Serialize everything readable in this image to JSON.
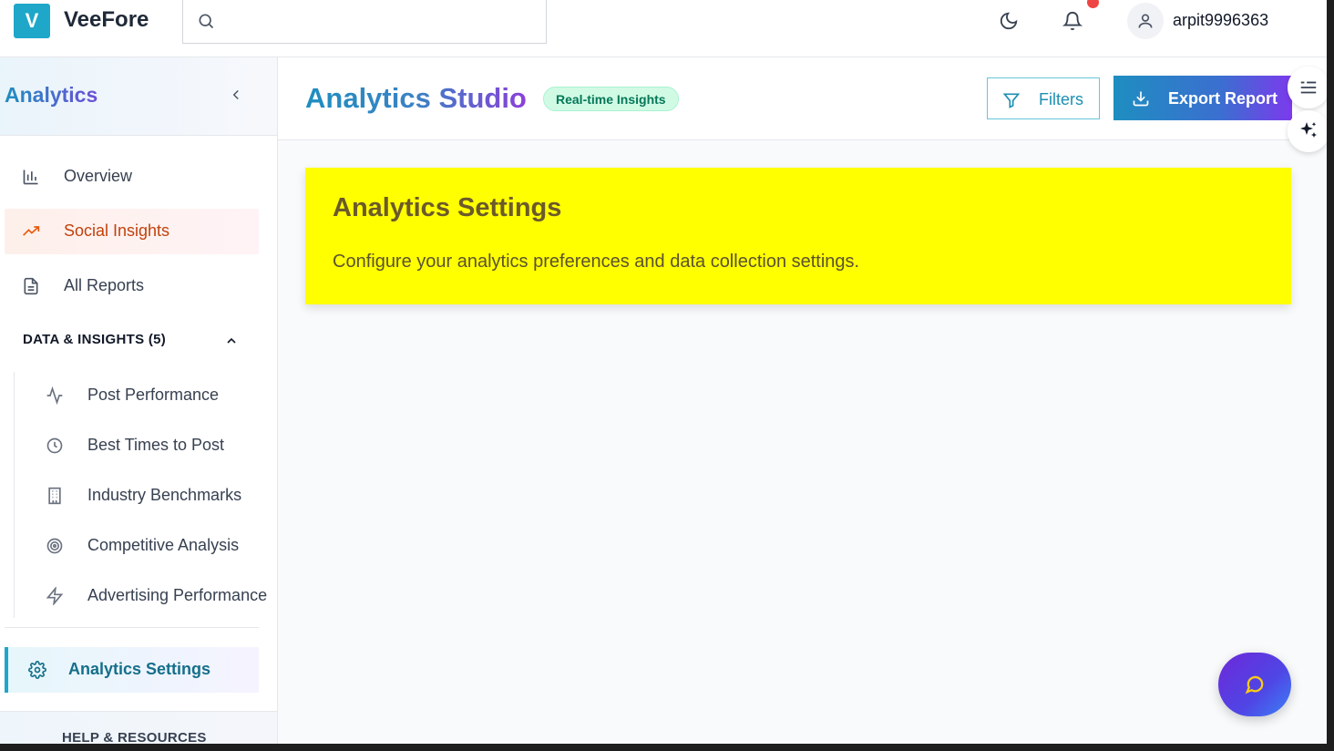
{
  "brand": {
    "logo_letter": "V",
    "name": "VeeFore",
    "accent": "#1ea7c9"
  },
  "search": {
    "placeholder": ""
  },
  "topbar": {
    "icons": [
      "moon-icon",
      "bell-icon",
      "user-icon"
    ],
    "notification_dot_color": "#ef4444",
    "username": "arpit9996363"
  },
  "sidebar": {
    "title": "Analytics",
    "items": [
      {
        "label": "Overview",
        "icon": "bar-chart-icon",
        "active": false
      },
      {
        "label": "Social Insights",
        "icon": "trending-up-icon",
        "active": true
      },
      {
        "label": "All Reports",
        "icon": "document-icon",
        "active": false
      }
    ],
    "section": {
      "label": "DATA & INSIGHTS (5)",
      "expanded": true,
      "items": [
        {
          "label": "Post Performance",
          "icon": "activity-icon"
        },
        {
          "label": "Best Times to Post",
          "icon": "clock-icon"
        },
        {
          "label": "Industry Benchmarks",
          "icon": "building-icon"
        },
        {
          "label": "Competitive Analysis",
          "icon": "target-icon"
        },
        {
          "label": "Advertising Performance",
          "icon": "zap-icon"
        }
      ]
    },
    "settings": {
      "label": "Analytics Settings",
      "icon": "gear-icon",
      "selected": true
    },
    "footer": {
      "label": "HELP & RESOURCES"
    }
  },
  "main": {
    "title": "Analytics Studio",
    "badge": "Real-time Insights",
    "filters_label": "Filters",
    "export_label": "Export Report",
    "card": {
      "title": "Analytics Settings",
      "description": "Configure your analytics preferences and data collection settings.",
      "background": "#ffff00"
    }
  },
  "floating": {
    "icons": [
      "text-list-icon",
      "sparkles-icon",
      "chat-icon"
    ],
    "chat_color": "#6d28d9"
  }
}
